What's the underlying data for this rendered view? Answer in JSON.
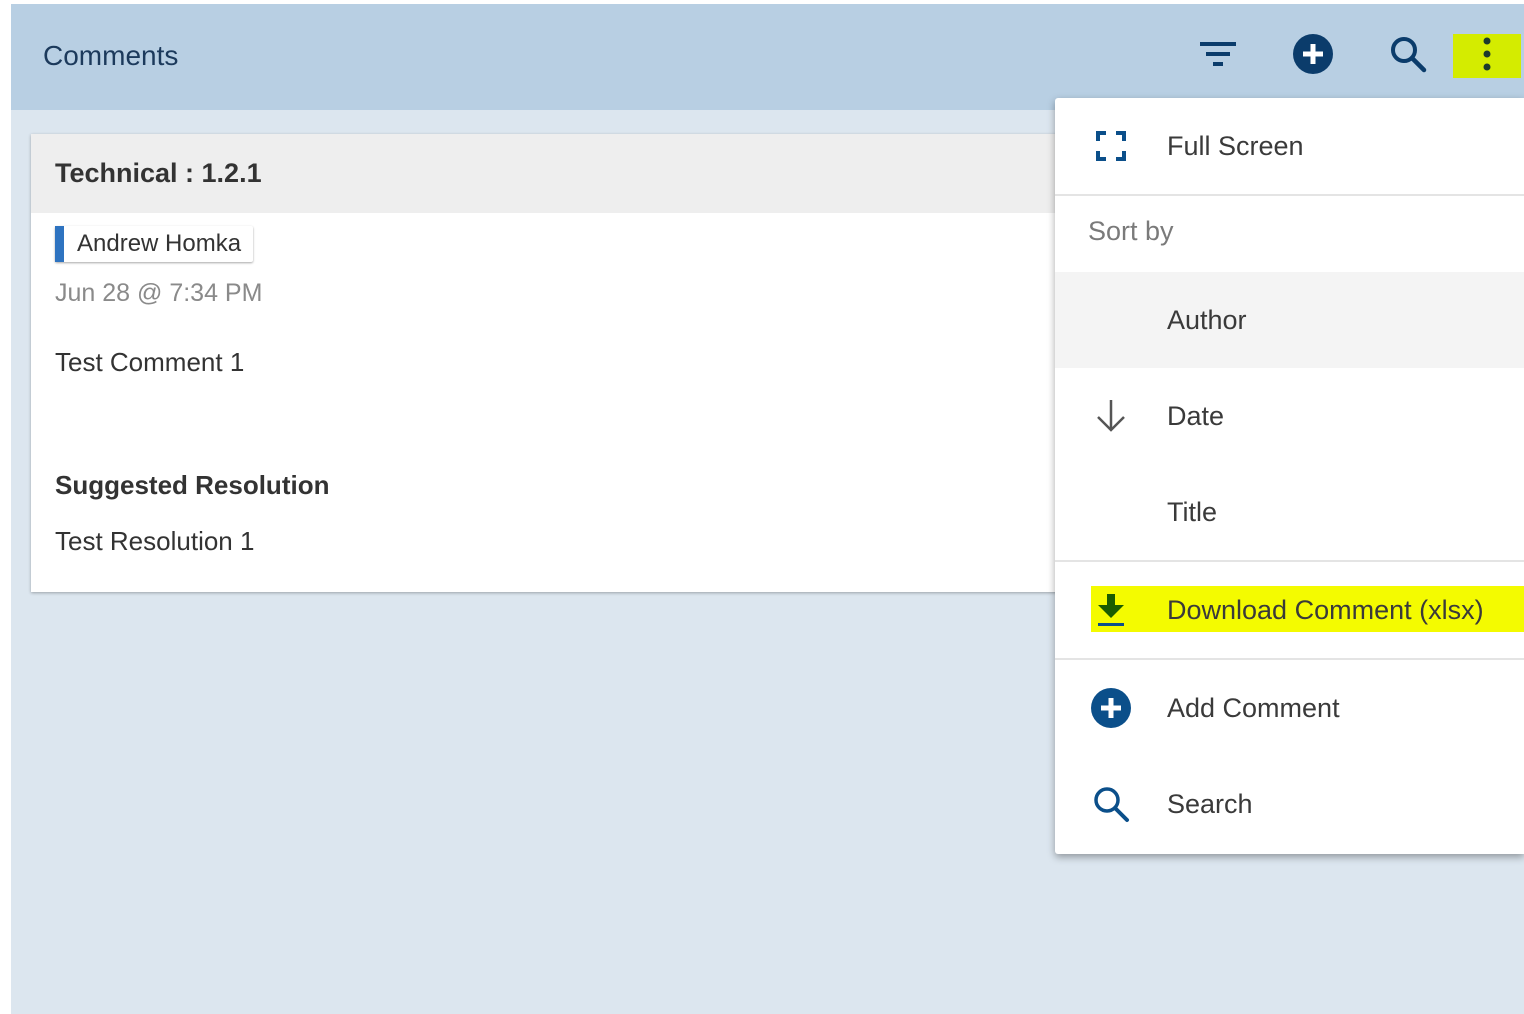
{
  "header": {
    "title": "Comments"
  },
  "toolbar": {
    "filter_icon": "filter-icon",
    "add_icon": "add-circle-icon",
    "search_icon": "search-icon",
    "more_icon": "more-vertical-icon"
  },
  "card": {
    "title": "Technical : 1.2.1",
    "author": "Andrew Homka",
    "timestamp": "Jun 28 @ 7:34 PM",
    "comment": "Test Comment 1",
    "resolution_heading": "Suggested Resolution",
    "resolution": "Test Resolution 1"
  },
  "menu": {
    "full_screen": "Full Screen",
    "sort_by": "Sort by",
    "sort_options": [
      {
        "label": "Author",
        "selected": true
      },
      {
        "label": "Date",
        "icon": "arrow-down-icon"
      },
      {
        "label": "Title"
      }
    ],
    "download": "Download Comment (xlsx)",
    "add_comment": "Add Comment",
    "search": "Search"
  },
  "colors": {
    "header_bg": "#b8cfe3",
    "panel_bg": "#dce6ef",
    "accent_blue": "#0b4f8a",
    "highlight_yellow": "#f4fb00",
    "download_icon": "#1a5c00"
  }
}
